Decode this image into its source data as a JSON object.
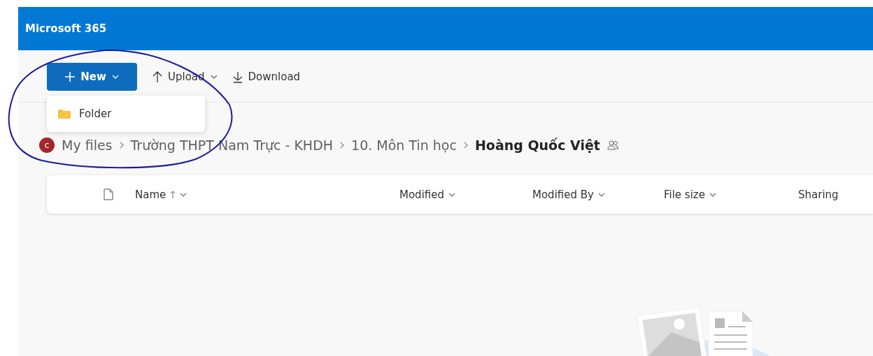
{
  "header": {
    "title": "Microsoft 365"
  },
  "toolbar": {
    "new_button": "New",
    "buttons": [
      {
        "label": "Upload",
        "kind": "upload",
        "has_menu": true
      },
      {
        "label": "Download",
        "kind": "download",
        "has_menu": false
      }
    ]
  },
  "new_menu": {
    "items": [
      {
        "label": "Folder",
        "kind": "folder"
      }
    ]
  },
  "breadcrumb": {
    "avatar": "c",
    "items": [
      {
        "label": "My files",
        "current": false
      },
      {
        "label": "Trường THPT Nam Trực - KHDH",
        "current": false
      },
      {
        "label": "10. Môn Tin học",
        "current": false
      },
      {
        "label": "Hoàng Quốc Việt",
        "current": true
      }
    ],
    "shared": true
  },
  "table": {
    "columns": [
      {
        "label": "Name",
        "sorted": true,
        "has_menu": true
      },
      {
        "label": "Modified",
        "sorted": false,
        "has_menu": true
      },
      {
        "label": "Modified By",
        "sorted": false,
        "has_menu": true
      },
      {
        "label": "File size",
        "sorted": false,
        "has_menu": true
      },
      {
        "label": "Sharing",
        "sorted": false,
        "has_menu": false
      }
    ]
  }
}
